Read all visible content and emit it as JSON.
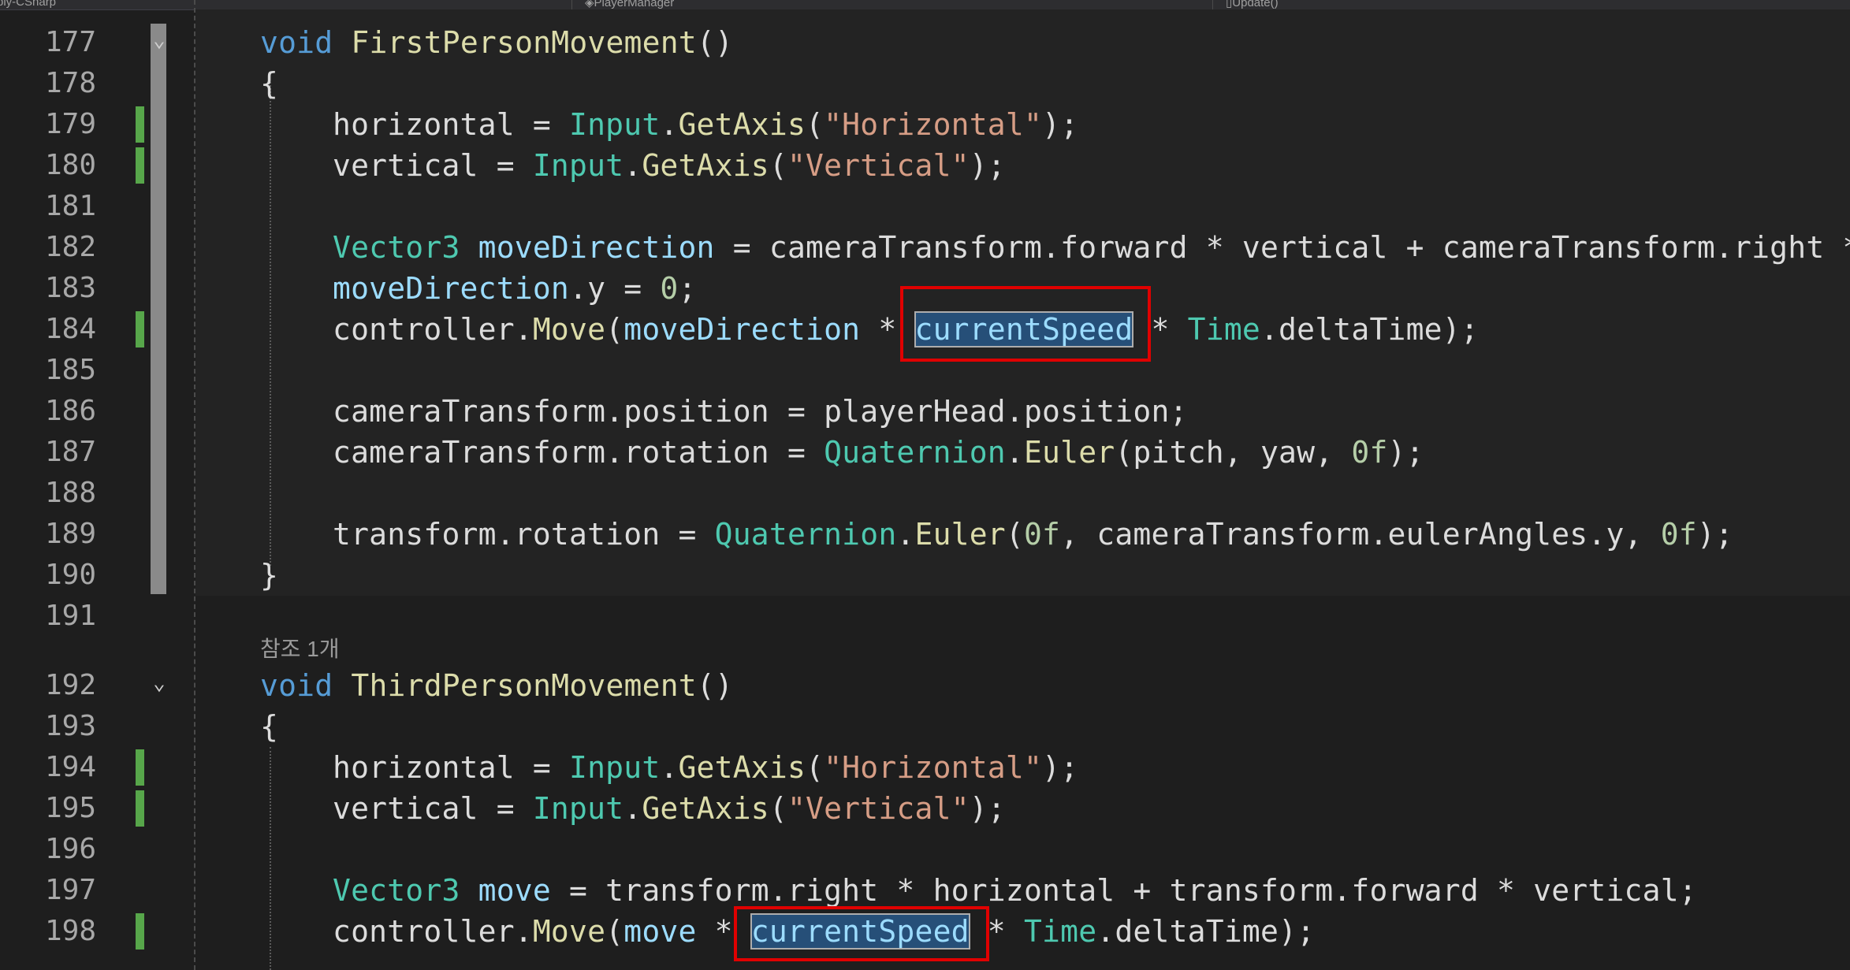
{
  "tabs": {
    "project": "bly-CSharp",
    "class": "PlayerManager",
    "member": "Update()"
  },
  "reference_label": "참조 1개",
  "lines": {
    "l177": {
      "num": "177",
      "kw": "void",
      "fn": "FirstPersonMovement",
      "rest": "()"
    },
    "l178": {
      "num": "178",
      "text": "{"
    },
    "l179": {
      "num": "179",
      "a": "horizontal = ",
      "ty": "Input",
      "dot": ".",
      "fn": "GetAxis",
      "p1": "(",
      "str": "\"Horizontal\"",
      "p2": ");"
    },
    "l180": {
      "num": "180",
      "a": "vertical = ",
      "ty": "Input",
      "dot": ".",
      "fn": "GetAxis",
      "p1": "(",
      "str": "\"Vertical\"",
      "p2": ");"
    },
    "l181": {
      "num": "181"
    },
    "l182": {
      "num": "182",
      "ty": "Vector3",
      "var": "moveDirection",
      "rest": " = cameraTransform.forward * vertical + cameraTransform.right *"
    },
    "l183": {
      "num": "183",
      "var": "moveDirection",
      "rest": ".y = ",
      "num_lit": "0",
      "end": ";"
    },
    "l184": {
      "num": "184",
      "a": "controller.",
      "fn": "Move",
      "p1": "(",
      "var": "moveDirection",
      "mid": " * ",
      "sel": "currentSpeed",
      "after": " * ",
      "ty": "Time",
      "end": ".deltaTime);"
    },
    "l185": {
      "num": "185"
    },
    "l186": {
      "num": "186",
      "text": "cameraTransform.position = playerHead.position;"
    },
    "l187": {
      "num": "187",
      "a": "cameraTransform.rotation = ",
      "ty": "Quaternion",
      "dot": ".",
      "fn": "Euler",
      "p1": "(pitch, yaw, ",
      "num_lit": "0f",
      "end": ");"
    },
    "l188": {
      "num": "188"
    },
    "l189": {
      "num": "189",
      "a": "transform.rotation = ",
      "ty": "Quaternion",
      "dot": ".",
      "fn": "Euler",
      "p1": "(",
      "n1": "0f",
      "mid": ", cameraTransform.eulerAngles.y, ",
      "n2": "0f",
      "end": ");"
    },
    "l190": {
      "num": "190",
      "text": "}"
    },
    "l191": {
      "num": "191"
    },
    "l192": {
      "num": "192",
      "kw": "void",
      "fn": "ThirdPersonMovement",
      "rest": "()"
    },
    "l193": {
      "num": "193",
      "text": "{"
    },
    "l194": {
      "num": "194",
      "a": "horizontal = ",
      "ty": "Input",
      "dot": ".",
      "fn": "GetAxis",
      "p1": "(",
      "str": "\"Horizontal\"",
      "p2": ");"
    },
    "l195": {
      "num": "195",
      "a": "vertical = ",
      "ty": "Input",
      "dot": ".",
      "fn": "GetAxis",
      "p1": "(",
      "str": "\"Vertical\"",
      "p2": ");"
    },
    "l196": {
      "num": "196"
    },
    "l197": {
      "num": "197",
      "ty": "Vector3",
      "var": "move",
      "rest": " = transform.right * horizontal + transform.forward * vertical;"
    },
    "l198": {
      "num": "198",
      "a": "controller.",
      "fn": "Move",
      "p1": "(",
      "var": "move",
      "mid": " * ",
      "sel": "currentSpeed",
      "after": " * ",
      "ty": "Time",
      "end": ".deltaTime);"
    }
  },
  "colors": {
    "background": "#1e1e1e",
    "keyword": "#569cd6",
    "method": "#dcdcaa",
    "type": "#4ec9b0",
    "string": "#d69d85",
    "number": "#b5cea8",
    "variable": "#9cdcfe",
    "change_marker": "#57a64a",
    "annotation_box": "#e00000",
    "selection": "#264f78"
  }
}
